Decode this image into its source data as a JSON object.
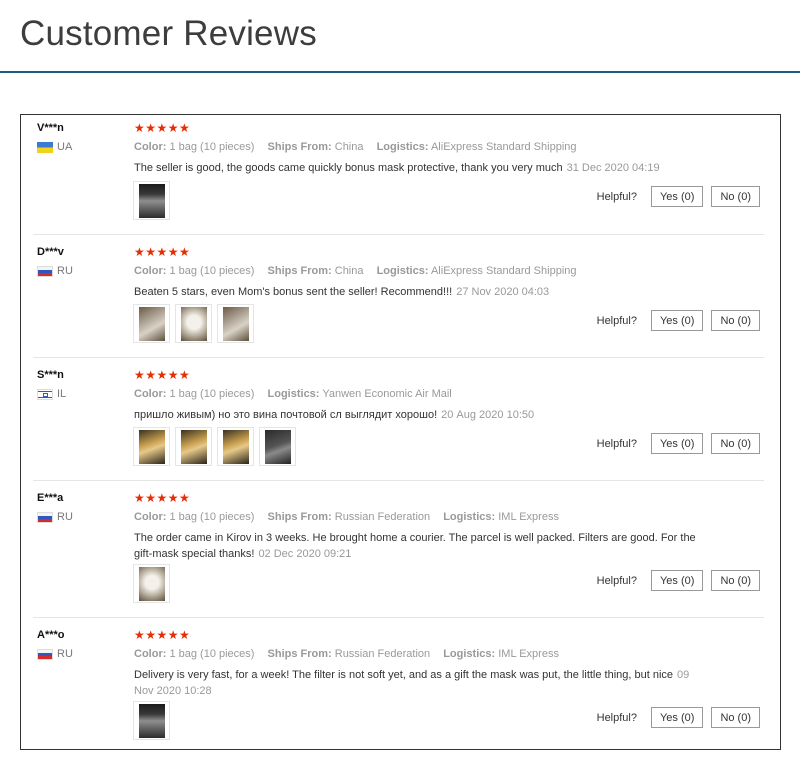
{
  "page": {
    "title": "Customer Reviews"
  },
  "labels": {
    "color": "Color:",
    "ships_from": "Ships From:",
    "logistics": "Logistics:",
    "helpful": "Helpful?"
  },
  "colors": {
    "star": "#e62e04",
    "header_rule": "#1d5c82"
  },
  "reviews": [
    {
      "name": "V***n",
      "country": "UA",
      "flag_icon": "ukraine-flag-icon",
      "stars": "★★★★★",
      "rating": 5,
      "color": "1 bag (10 pieces)",
      "ships_from": "China",
      "logistics": "AliExpress Standard Shipping",
      "text": "The seller is good, the goods came quickly bonus mask protective, thank you very much",
      "date": "31 Dec 2020 04:19",
      "yes": "Yes (0)",
      "no": "No (0)"
    },
    {
      "name": "D***v",
      "country": "RU",
      "flag_icon": "russia-flag-icon",
      "stars": "★★★★★",
      "rating": 5,
      "color": "1 bag (10 pieces)",
      "ships_from": "China",
      "logistics": "AliExpress Standard Shipping",
      "text": "Beaten 5 stars, even Mom's bonus sent the seller! Recommend!!!",
      "date": "27 Nov 2020 04:03",
      "yes": "Yes (0)",
      "no": "No (0)"
    },
    {
      "name": "S***n",
      "country": "IL",
      "flag_icon": "israel-flag-icon",
      "stars": "★★★★★",
      "rating": 5,
      "color": "1 bag (10 pieces)",
      "logistics": "Yanwen Economic Air Mail",
      "text": "пришло живым) но это вина почтовой сл выглядит хорошо!",
      "date": "20 Aug 2020 10:50",
      "yes": "Yes (0)",
      "no": "No (0)"
    },
    {
      "name": "E***a",
      "country": "RU",
      "flag_icon": "russia-flag-icon",
      "stars": "★★★★★",
      "rating": 5,
      "color": "1 bag (10 pieces)",
      "ships_from": "Russian Federation",
      "logistics": "IML Express",
      "text": "The order came in Kirov in 3 weeks. He brought home a courier. The parcel is well packed. Filters are good. For the gift-mask special thanks!",
      "date": "02 Dec 2020 09:21",
      "yes": "Yes (0)",
      "no": "No (0)"
    },
    {
      "name": "A***o",
      "country": "RU",
      "flag_icon": "russia-flag-icon",
      "stars": "★★★★★",
      "rating": 5,
      "color": "1 bag (10 pieces)",
      "ships_from": "Russian Federation",
      "logistics": "IML Express",
      "text": "Delivery is very fast, for a week! The filter is not soft yet, and as a gift the mask was put, the little thing, but nice",
      "date": "09 Nov 2020 10:28",
      "yes": "Yes (0)",
      "no": "No (0)"
    }
  ]
}
